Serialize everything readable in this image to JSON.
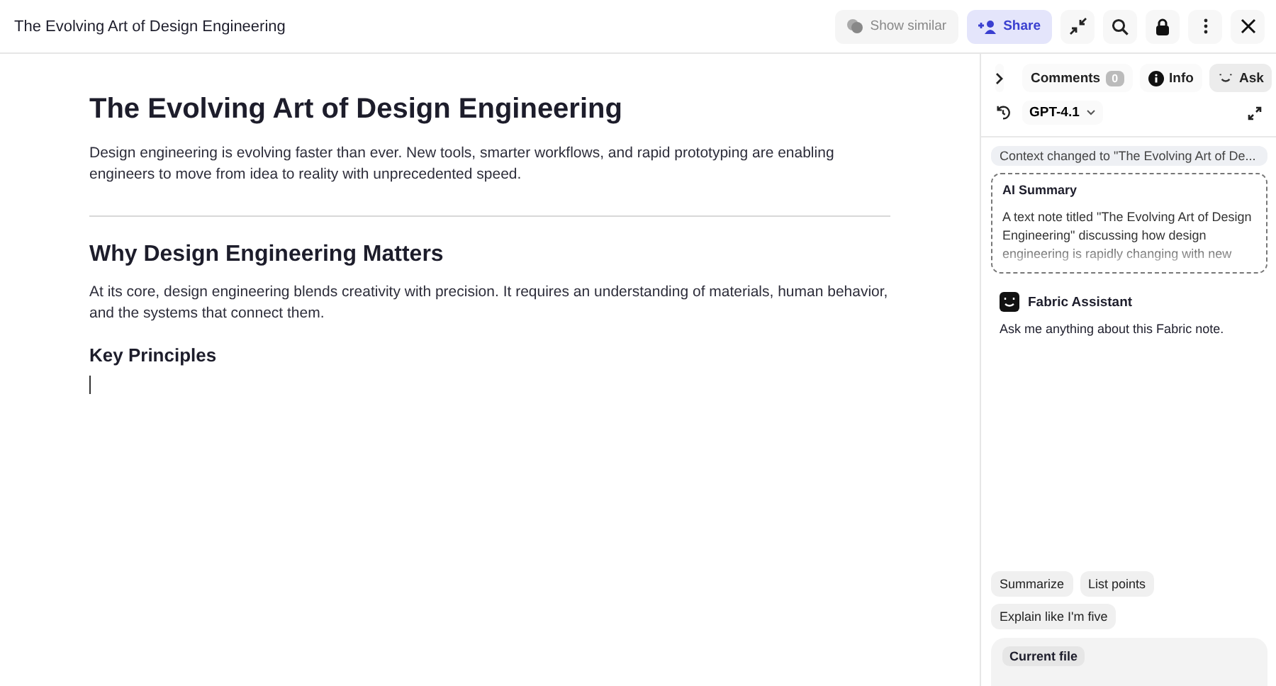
{
  "window": {
    "title": "The Evolving Art of Design Engineering"
  },
  "toolbar": {
    "show_similar": "Show similar",
    "share": "Share"
  },
  "document": {
    "title": "The Evolving Art of Design Engineering",
    "intro": "Design engineering is evolving faster than ever. New tools, smarter workflows, and rapid prototyping are enabling engineers to move from idea to reality with unprecedented speed.",
    "section_heading": "Why Design Engineering Matters",
    "section_text": "At its core, design engineering blends creativity with precision. It requires an understanding of materials, human behavior, and the systems that connect them.",
    "subheading": "Key Principles"
  },
  "panel": {
    "tabs": [
      {
        "kind": "comments",
        "label": "Comments",
        "count": "0",
        "selected": false
      },
      {
        "kind": "info",
        "label": "Info",
        "selected": false
      },
      {
        "kind": "ask",
        "label": "Ask",
        "selected": true
      }
    ],
    "model": "GPT-4.1",
    "context_notice": "Context changed to \"The Evolving Art of De...",
    "summary": {
      "title": "AI Summary",
      "text": "A text note titled \"The Evolving Art of Design Engineering\" discussing how design engineering is rapidly changing with new"
    },
    "assistant": {
      "name": "Fabric Assistant",
      "message": "Ask me anything about this Fabric note."
    },
    "suggestions": [
      "Summarize",
      "List points",
      "Explain like I'm five"
    ],
    "input_chip": "Current file"
  }
}
